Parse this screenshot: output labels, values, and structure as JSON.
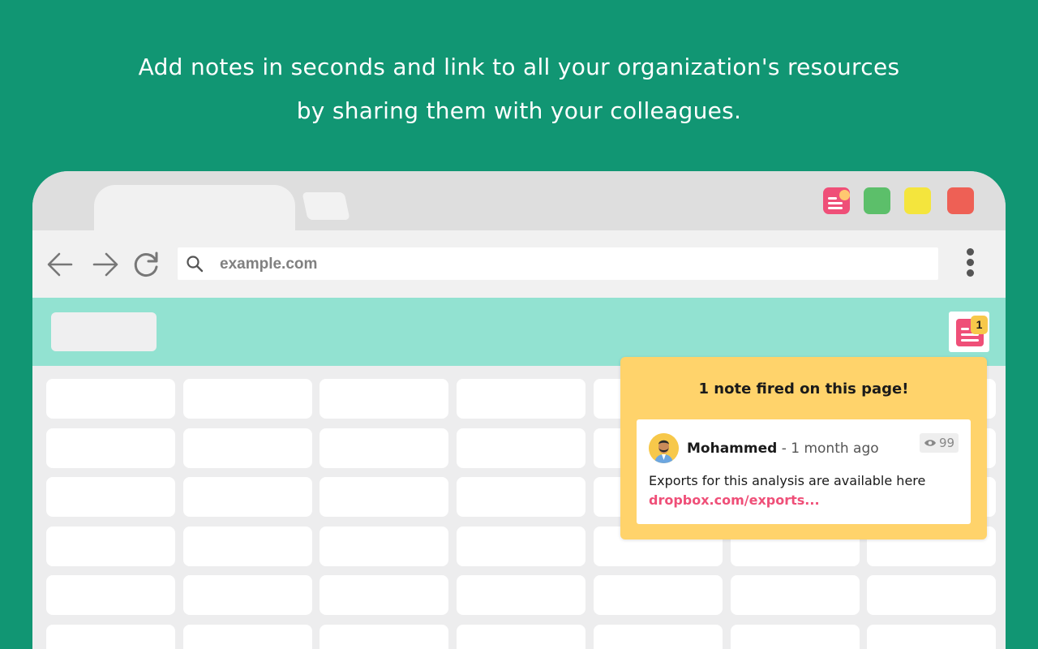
{
  "promo": {
    "line1": "Add notes in seconds and link to all your organization's resources",
    "line2": "by sharing them with your colleagues."
  },
  "browser": {
    "url": "example.com",
    "extension_icons": [
      "notes-extension-icon",
      "green-extension-icon",
      "yellow-extension-icon",
      "red-extension-icon"
    ],
    "nav_icons": [
      "back-arrow-icon",
      "forward-arrow-icon",
      "reload-icon",
      "search-icon",
      "more-options-icon"
    ]
  },
  "site": {
    "extension_badge": "1"
  },
  "note_popup": {
    "title": "1 note fired on this page!",
    "author": "Mohammed",
    "separator": " - ",
    "time": "1 month ago",
    "views": "99",
    "body": "Exports for this analysis are available here",
    "link": "dropbox.com/exports..."
  },
  "colors": {
    "background": "#119673",
    "site_header": "#92e2d1",
    "popup": "#ffd36b",
    "accent_pink": "#ef4f78",
    "badge_yellow": "#f7c84a"
  }
}
